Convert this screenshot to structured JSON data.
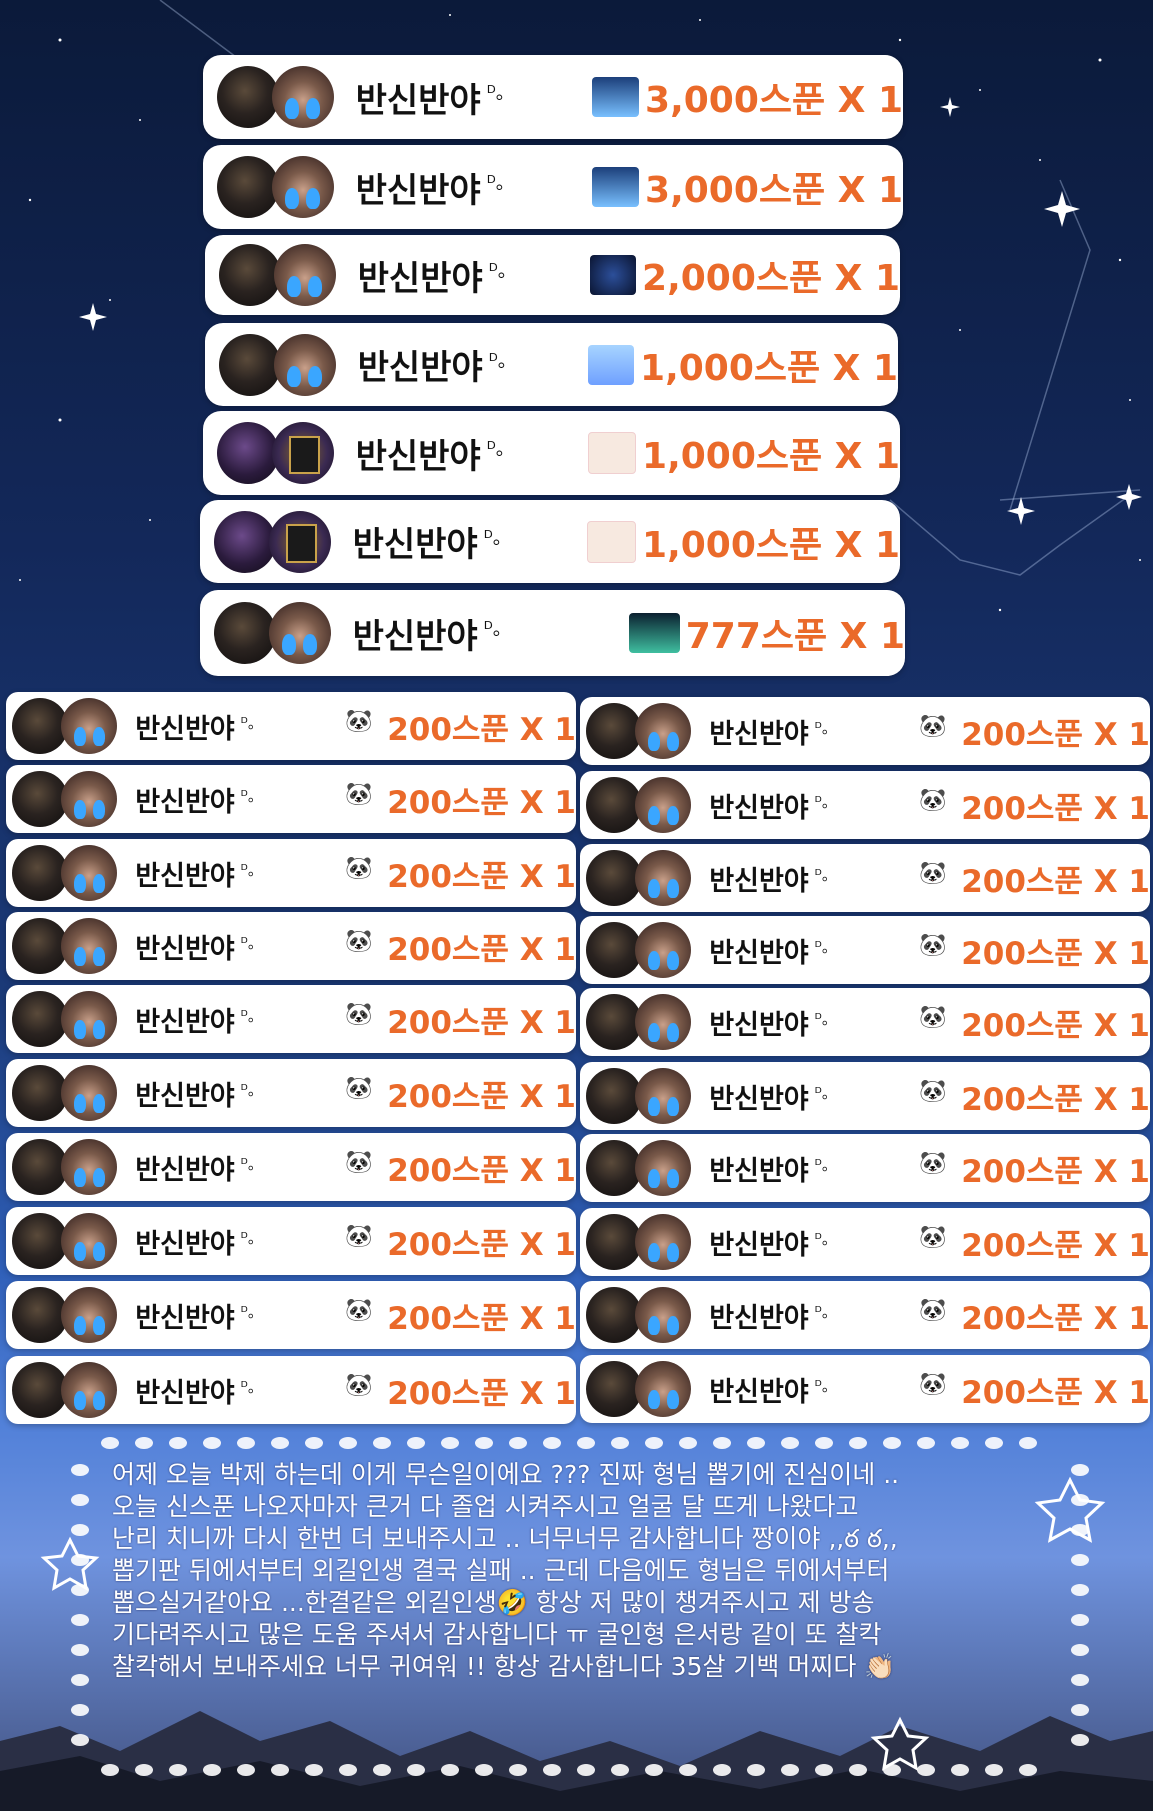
{
  "donor_name": "반신반야",
  "donor_suffix": "ᴰ。",
  "top_donations": [
    {
      "amount": "3,000스푼 X 1",
      "gift": "gift-3000-icon"
    },
    {
      "amount": "3,000스푼 X 1",
      "gift": "gift-3000-icon"
    },
    {
      "amount": "2,000스푼 X 1",
      "gift": "gift-2000-icon"
    },
    {
      "amount": "1,000스푼 X 1",
      "gift": "gift-1000a-icon"
    },
    {
      "amount": "1,000스푼 X 1",
      "gift": "gift-1000b-icon"
    },
    {
      "amount": "1,000스푼 X 1",
      "gift": "gift-1000b-icon"
    },
    {
      "amount": "777스푼 X 1",
      "gift": "gift-777-icon"
    }
  ],
  "small_amount": "200스푼 X 1",
  "small_gift_glyph": "🐼",
  "message_lines": [
    "어제 오늘 박제 하는데 이게 무슨일이에요 ??? 진짜 형님 뽑기에 진심이네 ..",
    "오늘 신스푼 나오자마자 큰거 다 졸업 시켜주시고 얼굴 달 뜨게 나왔다고",
    "난리 치니까 다시 한번 더 보내주시고 .. 너무너무 감사합니다 짱이야 ‚,ఠ ఠ,,",
    "뽑기판 뒤에서부터 외길인생 결국 실패 .. 근데 다음에도 형님은 뒤에서부터",
    "뽑으실거같아요 ...한결같은 외길인생🤣 항상 저 많이 챙겨주시고 제 방송",
    "기다려주시고 많은 도움 주셔서 감사합니다 ㅠ 굴인형 은서랑 같이 또 찰칵",
    "찰칵해서 보내주세요 너무 귀여워 !! 항상 감사합니다 35살 기백 머찌다 👏🏻"
  ],
  "colors": {
    "amount": "#ea6a2a",
    "name": "#111111",
    "tear": "#3aa6ff",
    "card": "#ffffff"
  }
}
